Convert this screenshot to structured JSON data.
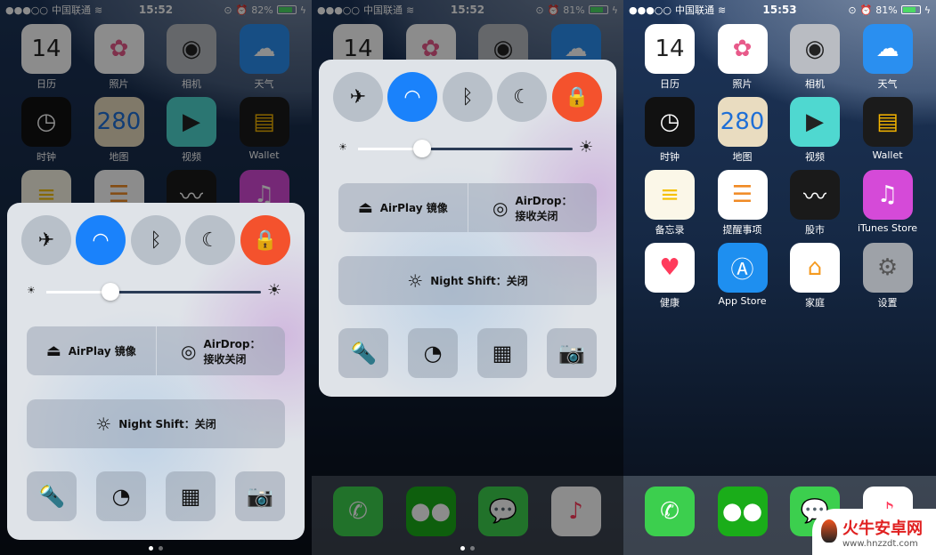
{
  "screens": [
    {
      "status": {
        "signal": "●●●○○",
        "carrier": "中国联通",
        "time": "15:52",
        "battery": "82%",
        "battery_level": 0.82
      },
      "control_center": true,
      "dock_visible": false
    },
    {
      "status": {
        "signal": "●●●○○",
        "carrier": "中国联通",
        "time": "15:52",
        "battery": "81%",
        "battery_level": 0.81
      },
      "control_center": true,
      "dock_visible": true
    },
    {
      "status": {
        "signal": "●●●○○",
        "carrier": "中国联通",
        "time": "15:53",
        "battery": "81%",
        "battery_level": 0.81
      },
      "control_center": false,
      "dock_visible": true
    }
  ],
  "apps": [
    {
      "label": "日历",
      "icon": "calendar-icon",
      "glyph": "14",
      "bg": "#ffffff",
      "fg": "#222"
    },
    {
      "label": "照片",
      "icon": "photos-icon",
      "glyph": "✿",
      "bg": "#ffffff",
      "fg": "#e85a8a"
    },
    {
      "label": "相机",
      "icon": "camera-icon",
      "glyph": "◉",
      "bg": "#b9bcc2",
      "fg": "#222"
    },
    {
      "label": "天气",
      "icon": "weather-icon",
      "glyph": "☁",
      "bg": "#2a8ff0",
      "fg": "#fff"
    },
    {
      "label": "时钟",
      "icon": "clock-icon",
      "glyph": "◷",
      "bg": "#111111",
      "fg": "#fff"
    },
    {
      "label": "地图",
      "icon": "maps-icon",
      "glyph": "280",
      "bg": "#e9dcc0",
      "fg": "#1f6fd6"
    },
    {
      "label": "视频",
      "icon": "videos-icon",
      "glyph": "▶",
      "bg": "#4fd8d0",
      "fg": "#222"
    },
    {
      "label": "Wallet",
      "icon": "wallet-icon",
      "glyph": "▤",
      "bg": "#1b1b1b",
      "fg": "#f4b400"
    },
    {
      "label": "备忘录",
      "icon": "notes-icon",
      "glyph": "≡",
      "bg": "#fbf7e8",
      "fg": "#f5c000"
    },
    {
      "label": "提醒事项",
      "icon": "reminders-icon",
      "glyph": "☰",
      "bg": "#ffffff",
      "fg": "#f08a24"
    },
    {
      "label": "股市",
      "icon": "stocks-icon",
      "glyph": "〰",
      "bg": "#1a1a1a",
      "fg": "#fff"
    },
    {
      "label": "iTunes Store",
      "icon": "itunes-icon",
      "glyph": "♫",
      "bg": "#d54ad8",
      "fg": "#fff"
    },
    {
      "label": "健康",
      "icon": "health-icon",
      "glyph": "♥",
      "bg": "#ffffff",
      "fg": "#ff3b5c"
    },
    {
      "label": "App Store",
      "icon": "appstore-icon",
      "glyph": "Ⓐ",
      "bg": "#1e8ff0",
      "fg": "#fff"
    },
    {
      "label": "家庭",
      "icon": "home-icon",
      "glyph": "⌂",
      "bg": "#ffffff",
      "fg": "#f59a1f"
    },
    {
      "label": "设置",
      "icon": "settings-icon",
      "glyph": "⚙",
      "bg": "#9ea2a8",
      "fg": "#555"
    }
  ],
  "dock": [
    {
      "icon": "phone-icon",
      "glyph": "✆",
      "bg": "#3ccf4e",
      "fg": "#fff"
    },
    {
      "icon": "wechat-icon",
      "glyph": "●●",
      "bg": "#1aad19",
      "fg": "#fff"
    },
    {
      "icon": "messages-icon",
      "glyph": "💬",
      "bg": "#3ccf4e",
      "fg": "#fff"
    },
    {
      "icon": "music-icon",
      "glyph": "♪",
      "bg": "#ffffff",
      "fg": "#ff3b5c"
    }
  ],
  "control_center": {
    "toggles": [
      {
        "name": "airplane-mode",
        "glyph": "✈",
        "active": false,
        "color": "#b8c0c9"
      },
      {
        "name": "wifi",
        "glyph": "◠",
        "active": true,
        "color": "#1a82fb"
      },
      {
        "name": "bluetooth",
        "glyph": "ᛒ",
        "active": false,
        "color": "#b8c0c9"
      },
      {
        "name": "do-not-disturb",
        "glyph": "☾",
        "active": false,
        "color": "#b8c0c9"
      },
      {
        "name": "rotation-lock",
        "glyph": "🔒",
        "active": true,
        "color": "#f4522d"
      }
    ],
    "brightness": 0.3,
    "airplay_label": "AirPlay 镜像",
    "airdrop_title": "AirDrop：",
    "airdrop_status": "接收关闭",
    "night_shift_label": "Night Shift：关闭",
    "shortcuts": [
      {
        "name": "flashlight",
        "glyph": "🔦"
      },
      {
        "name": "timer",
        "glyph": "◔"
      },
      {
        "name": "calculator",
        "glyph": "▦"
      },
      {
        "name": "camera",
        "glyph": "📷"
      }
    ],
    "pages": 2,
    "current_page": 1
  },
  "watermark": {
    "title": "火牛安卓网",
    "url": "www.hnzzdt.com"
  }
}
